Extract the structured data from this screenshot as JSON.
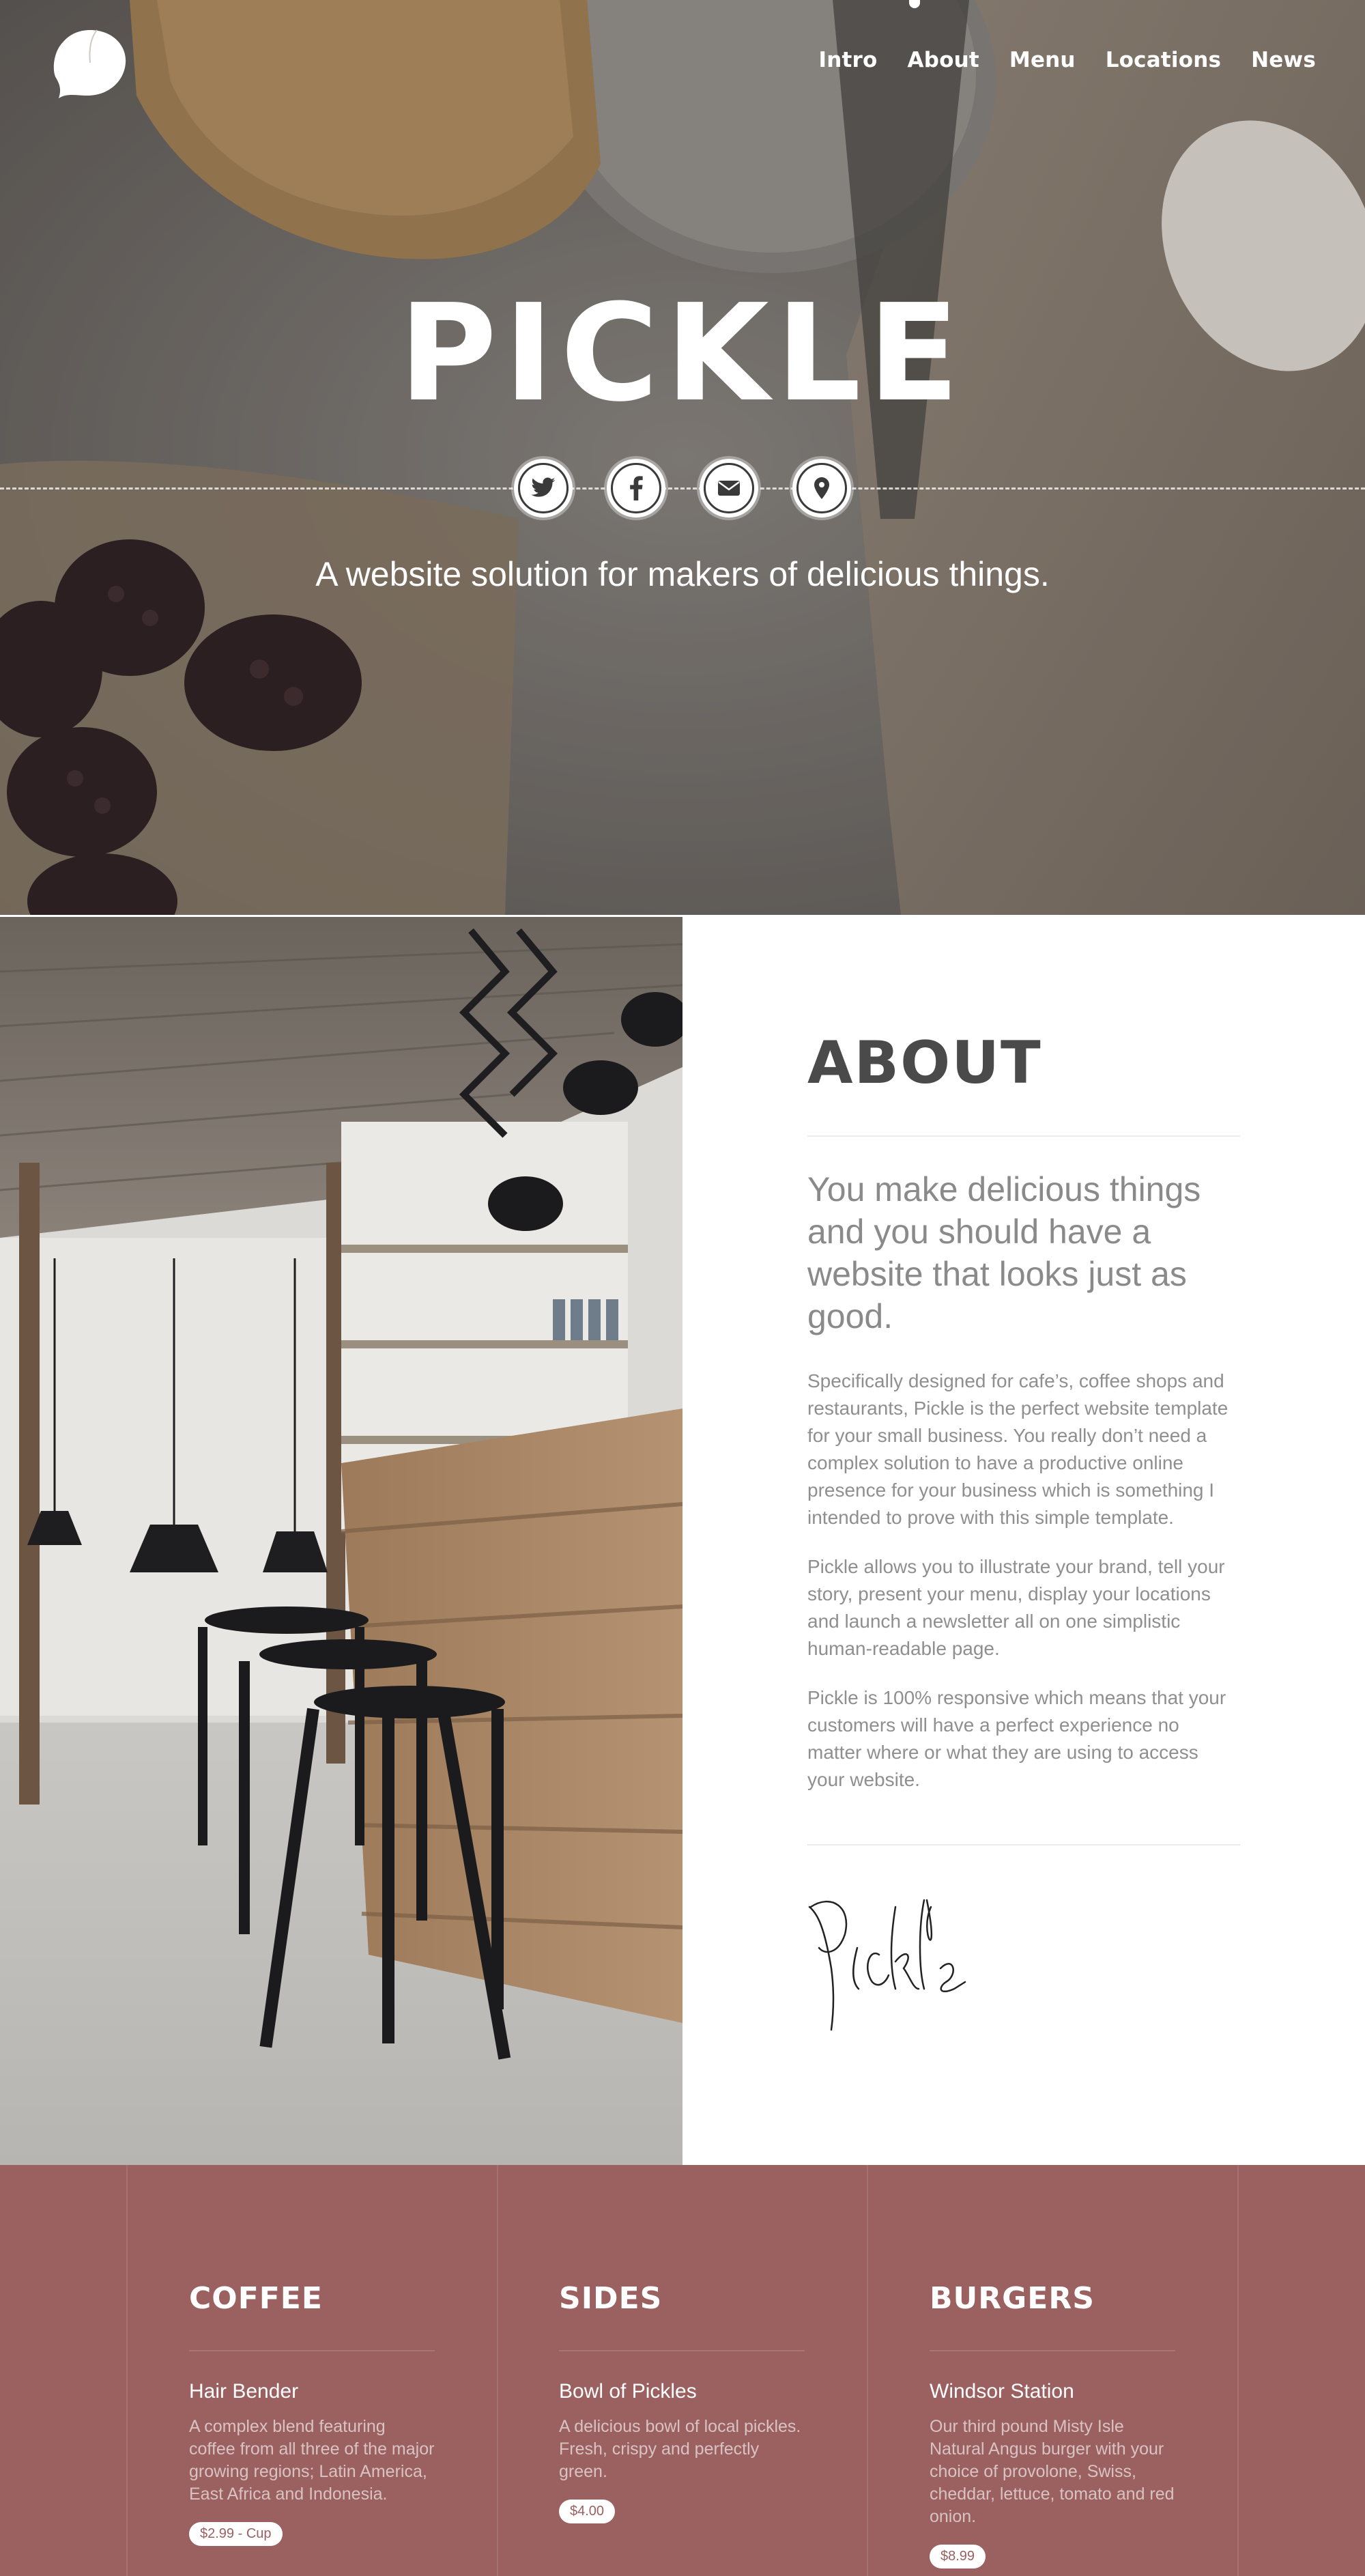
{
  "nav": {
    "items": [
      "Intro",
      "About",
      "Menu",
      "Locations",
      "News"
    ]
  },
  "hero": {
    "title": "PICKLE",
    "tagline": "A website solution for makers of delicious things.",
    "socials": [
      {
        "icon": "twitter-icon"
      },
      {
        "icon": "facebook-icon"
      },
      {
        "icon": "mail-icon"
      },
      {
        "icon": "location-pin-icon"
      }
    ]
  },
  "about": {
    "title": "ABOUT",
    "lead": "You make delicious things and you should have a website that looks just as good.",
    "paragraphs": [
      "Specifically designed for cafe’s, coffee shops and restaurants, Pickle is the perfect website template for your small business. You really don’t need a complex solution to have a productive online presence for your business which is something I intended to prove with this simple template.",
      "Pickle allows you to illustrate your brand, tell your story, present your menu, display your locations and launch a newsletter all on one simplistic human-readable page.",
      "Pickle is 100% responsive which means that your customers will have a perfect experience no matter where or what they are using to access your website."
    ],
    "signature": "Pickle"
  },
  "menu": {
    "columns": [
      {
        "title": "COFFEE",
        "item_name": "Hair Bender",
        "item_desc": "A complex blend featuring coffee from all three of the major growing regions; Latin America, East Africa and Indonesia.",
        "price": "$2.99 - Cup"
      },
      {
        "title": "SIDES",
        "item_name": "Bowl of Pickles",
        "item_desc": "A delicious bowl of local pickles. Fresh, crispy and perfectly green.",
        "price": "$4.00"
      },
      {
        "title": "BURGERS",
        "item_name": "Windsor Station",
        "item_desc": "Our third pound Misty Isle Natural Angus burger with your choice of provolone, Swiss, cheddar, lettuce, tomato and red onion.",
        "price": "$8.99"
      }
    ]
  },
  "colors": {
    "menu_bg": "#9b6060",
    "about_title": "#4a4a4a",
    "text_muted": "#8f8f8f"
  }
}
